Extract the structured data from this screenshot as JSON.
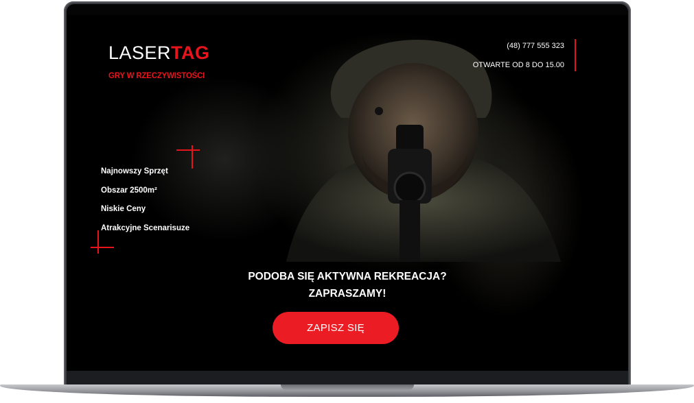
{
  "brand": {
    "logo_part1": "LASER",
    "logo_part2": "TAG",
    "tagline": "GRY W RZECZYWISTOŚCI"
  },
  "contact": {
    "phone": "(48) 777 555 323",
    "hours": "OTWARTE OD 8 DO 15.00"
  },
  "features": [
    "Najnowszy Sprzęt",
    "Obszar 2500m²",
    "Niskie Ceny",
    "Atrakcyjne Scenarisuze"
  ],
  "headline": {
    "line1": "PODOBA SIĘ AKTYWNA REKREACJA?",
    "line2": "ZAPRASZAMY!"
  },
  "cta": {
    "label": "ZAPISZ SIĘ"
  },
  "colors": {
    "accent": "#e8141c",
    "button": "#ec1c24",
    "background": "#000000",
    "frame": "#3a3b3f"
  }
}
